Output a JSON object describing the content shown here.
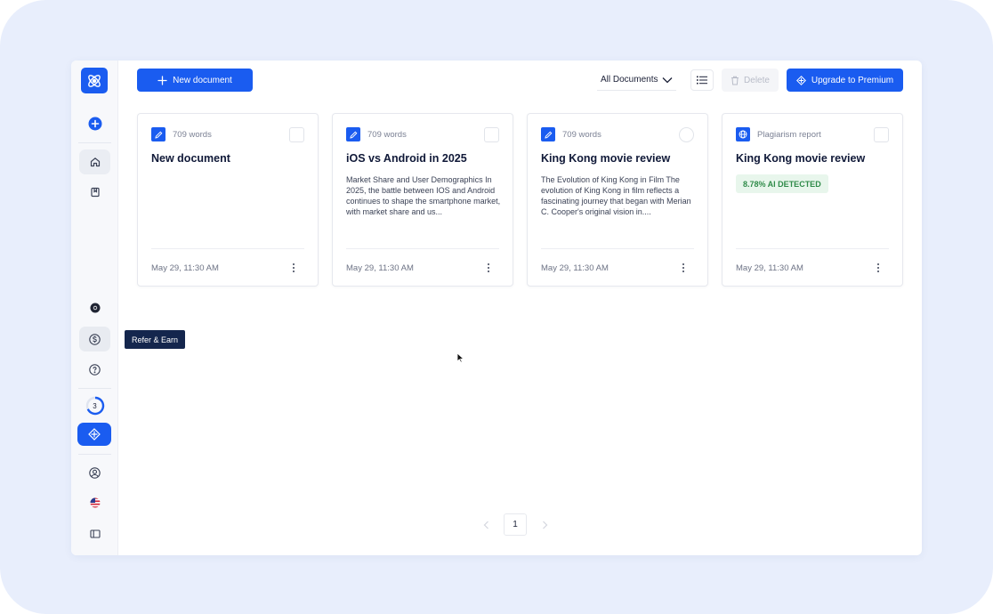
{
  "toolbar": {
    "new_document_label": "New document",
    "filter_value": "All Documents",
    "delete_label": "Delete",
    "upgrade_label": "Upgrade to Premium"
  },
  "sidebar": {
    "tooltip": "Refer & Earn",
    "credits_count": "3",
    "icons": [
      "logo-icon",
      "add-icon",
      "home-icon",
      "bookmark-icon",
      "chrome-icon",
      "dollar-icon",
      "help-icon",
      "credits-progress-icon",
      "premium-icon",
      "account-icon",
      "us-flag-icon",
      "panel-toggle-icon"
    ]
  },
  "documents": [
    {
      "meta": "709 words",
      "title": "New document",
      "excerpt": "",
      "badge": "",
      "date": "May 29, 11:30 AM",
      "icon": "pencil-icon"
    },
    {
      "meta": "709 words",
      "title": "iOS vs Android in 2025",
      "excerpt": "Market Share and User Demographics In 2025, the battle between IOS and Android continues to shape the smartphone market, with market share and us...",
      "badge": "",
      "date": "May 29, 11:30 AM",
      "icon": "pencil-icon"
    },
    {
      "meta": "709 words",
      "title": "King Kong movie review",
      "excerpt": "The Evolution of King Kong in Film The evolution of King Kong in film reflects a fascinating journey that began with Merian C. Cooper's original vision in....",
      "badge": "",
      "date": "May 29, 11:30 AM",
      "icon": "pencil-icon"
    },
    {
      "meta": "Plagiarism report",
      "title": "King Kong movie review",
      "excerpt": "",
      "badge": "8.78% AI DETECTED",
      "date": "May 29, 11:30 AM",
      "icon": "globe-icon"
    }
  ],
  "pagination": {
    "current_page": "1"
  },
  "colors": {
    "primary": "#1a5cf0",
    "tooltip_bg": "#14264d",
    "badge_bg": "#e8f6ec",
    "badge_text": "#2f8b49",
    "frame_bg": "#e8eefc"
  }
}
